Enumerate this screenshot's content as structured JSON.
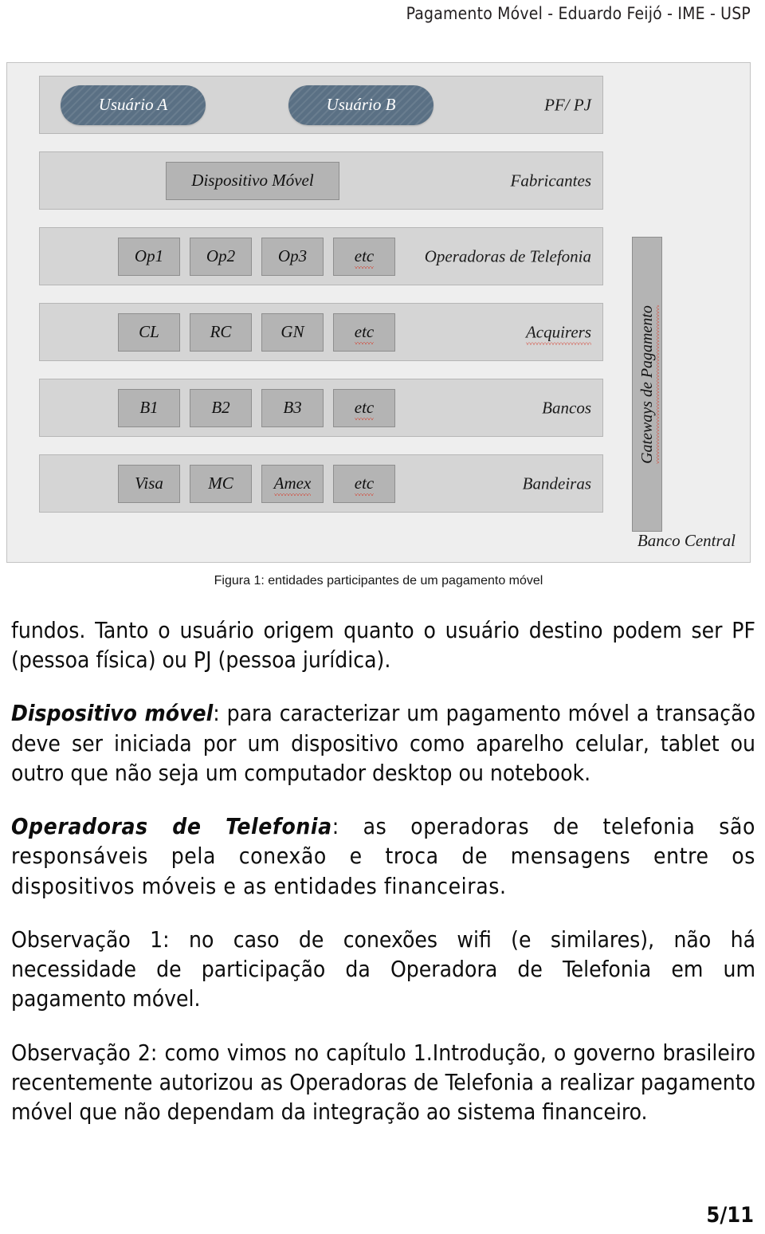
{
  "header": {
    "running_title": "Pagamento Móvel - Eduardo Feijó - IME - USP"
  },
  "figure": {
    "caption": "Figura 1: entidades  participantes de um pagamento móvel",
    "outer_label": "Banco Central",
    "vertical_bar_label": "Gateways de Pagamento",
    "rows": [
      {
        "name": "usuarios",
        "right_label": "PF/ PJ",
        "items": [
          "Usuário A",
          "Usuário B"
        ]
      },
      {
        "name": "dispositivo",
        "right_label": "Fabricantes",
        "items": [
          "Dispositivo Móvel"
        ]
      },
      {
        "name": "operadoras",
        "right_label": "Operadoras de Telefonia",
        "items": [
          "Op1",
          "Op2",
          "Op3",
          "etc"
        ]
      },
      {
        "name": "acquirers",
        "right_label": "Acquirers",
        "items": [
          "CL",
          "RC",
          "GN",
          "etc"
        ]
      },
      {
        "name": "bancos",
        "right_label": "Bancos",
        "items": [
          "B1",
          "B2",
          "B3",
          "etc"
        ]
      },
      {
        "name": "bandeiras",
        "right_label": "Bandeiras",
        "items": [
          "Visa",
          "MC",
          "Amex",
          "etc"
        ]
      }
    ],
    "colors": {
      "outer_background": "#eeeeee",
      "row_background": "#d5d5d5",
      "box_background": "#b4b4b4",
      "pill_background": "#5a7084",
      "pill_text": "#ffffff",
      "spellcheck_underline": "#d63b2a"
    }
  },
  "body": {
    "paragraphs": [
      {
        "id": "p-fundos",
        "lead": "",
        "text": "fundos. Tanto o usuário origem quanto o usuário destino podem ser PF (pessoa física) ou PJ (pessoa jurídica)."
      },
      {
        "id": "p-dispositivo",
        "lead": "Dispositivo móvel",
        "text": ": para caracterizar um pagamento móvel a transação deve ser iniciada por um dispositivo como aparelho celular, tablet ou outro que não seja um computador desktop ou notebook."
      },
      {
        "id": "p-operadoras",
        "lead": "Operadoras de Telefonia",
        "text": ": as operadoras de telefonia são responsáveis pela conexão e troca de mensagens entre os dispositivos móveis e as entidades financeiras."
      },
      {
        "id": "p-obs1",
        "lead": "",
        "text": "Observação 1: no caso de conexões wifi (e similares), não há necessidade de participação da Operadora de Telefonia em um pagamento móvel."
      },
      {
        "id": "p-obs2",
        "lead": "",
        "text": "Observação 2: como vimos no capítulo 1.Introdução, o governo brasileiro recentemente autorizou as Operadoras de Telefonia a realizar pagamento móvel que não dependam da integração ao sistema financeiro."
      }
    ]
  },
  "footer": {
    "page_number": "5/11"
  }
}
